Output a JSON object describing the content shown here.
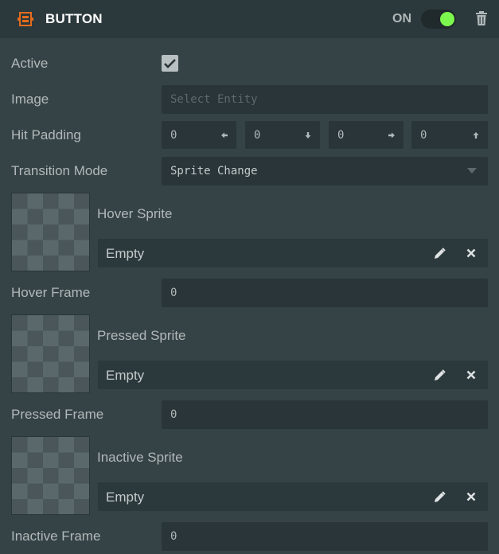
{
  "header": {
    "title": "BUTTON",
    "toggle_label": "ON",
    "toggle_state": "on",
    "accent_color": "#e56b1d",
    "toggle_color": "#7cf74e",
    "logo_icon": "button-component-icon",
    "delete_icon": "trash-icon"
  },
  "rows": {
    "active": {
      "label": "Active",
      "checked": true
    },
    "image": {
      "label": "Image",
      "placeholder": "Select Entity"
    },
    "hit_padding": {
      "label": "Hit Padding",
      "values": [
        "0",
        "0",
        "0",
        "0"
      ],
      "icons": [
        "arrow-left-icon",
        "arrow-down-icon",
        "arrow-right-icon",
        "arrow-up-icon"
      ]
    },
    "transition_mode": {
      "label": "Transition Mode",
      "value": "Sprite Change"
    },
    "hover_sprite": {
      "label": "Hover Sprite",
      "value": "Empty"
    },
    "hover_frame": {
      "label": "Hover Frame",
      "value": "0"
    },
    "pressed_sprite": {
      "label": "Pressed Sprite",
      "value": "Empty"
    },
    "pressed_frame": {
      "label": "Pressed Frame",
      "value": "0"
    },
    "inactive_sprite": {
      "label": "Inactive Sprite",
      "value": "Empty"
    },
    "inactive_frame": {
      "label": "Inactive Frame",
      "value": "0"
    }
  }
}
